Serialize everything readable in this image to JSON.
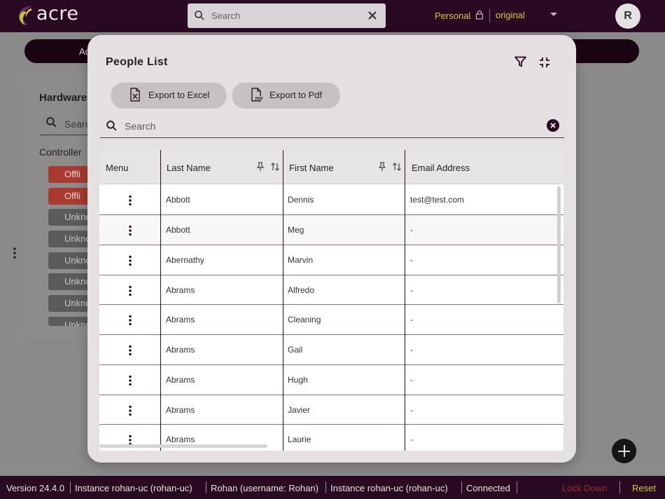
{
  "app": {
    "logo_text": "acre",
    "search_placeholder": "Search",
    "workspace_label": "Personal",
    "view_label": "original",
    "avatar_initial": "R",
    "colors": {
      "header_bg": "#2a0a22",
      "accent_yellow": "#d6c93a",
      "offline_red": "#a83a30"
    }
  },
  "background": {
    "nav_pill_label": "Ac",
    "card_title": "Hardware",
    "card_search_placeholder": "Searc",
    "controllers_label": "Controller",
    "statuses": [
      "Offli",
      "Offli",
      "Unkno",
      "Unkno",
      "Unkno",
      "Unkno",
      "Unkno",
      "Unkno"
    ]
  },
  "modal": {
    "title": "People List",
    "export_excel_label": "Export to Excel",
    "export_pdf_label": "Export to Pdf",
    "search_placeholder": "Search",
    "columns": {
      "menu": "Menu",
      "last_name": "Last Name",
      "first_name": "First Name",
      "email": "Email Address"
    },
    "rows": [
      {
        "last": "Abbott",
        "first": "Dennis",
        "email": "test@test.com"
      },
      {
        "last": "Abbott",
        "first": "Meg",
        "email": "-"
      },
      {
        "last": "Abernathy",
        "first": "Marvin",
        "email": "-"
      },
      {
        "last": "Abrams",
        "first": "Alfredo",
        "email": "-"
      },
      {
        "last": "Abrams",
        "first": "Cleaning",
        "email": "-"
      },
      {
        "last": "Abrams",
        "first": "Gail",
        "email": "-"
      },
      {
        "last": "Abrams",
        "first": "Hugh",
        "email": "-"
      },
      {
        "last": "Abrams",
        "first": "Javier",
        "email": "-"
      },
      {
        "last": "Abrams",
        "first": "Laurie",
        "email": "-"
      }
    ]
  },
  "footer": {
    "version": "Version 24.4.0",
    "instance1": "Instance rohan-uc (rohan-uc)",
    "user": "Rohan (username: Rohan)",
    "instance2": "Instance rohan-uc (rohan-uc)",
    "connection": "Connected",
    "lockdown": "Lock Down",
    "reset": "Reset"
  }
}
